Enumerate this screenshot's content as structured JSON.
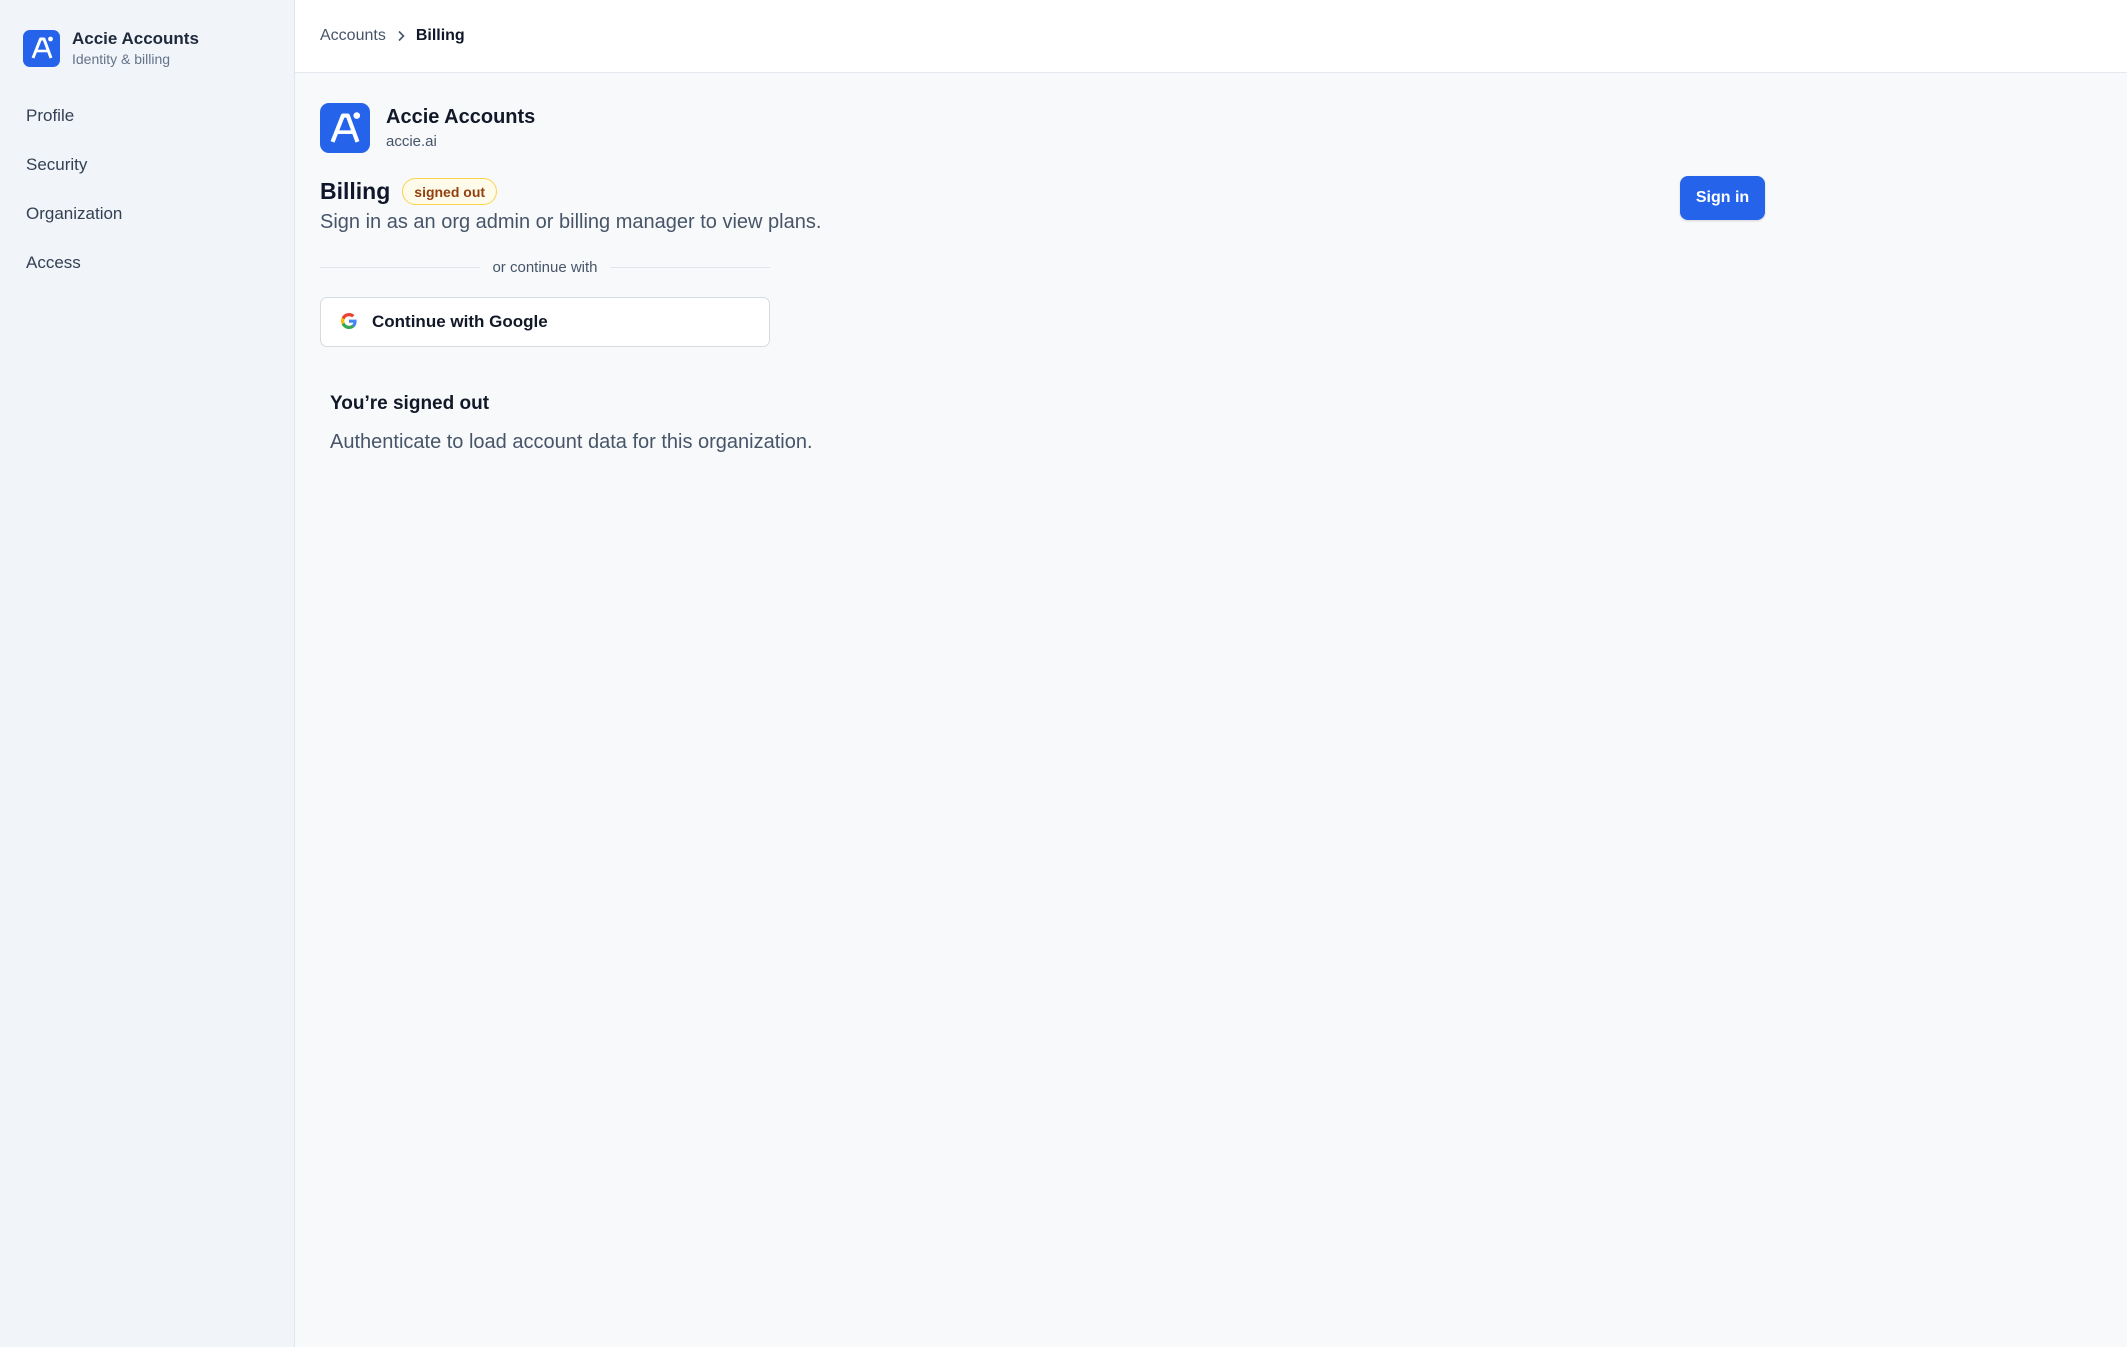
{
  "sidebar": {
    "brand": {
      "title": "Accie Accounts",
      "subtitle": "Identity & billing",
      "logo_icon": "accie-logo-icon"
    },
    "items": [
      {
        "label": "Profile"
      },
      {
        "label": "Security"
      },
      {
        "label": "Organization"
      },
      {
        "label": "Access"
      }
    ]
  },
  "breadcrumb": {
    "parent": "Accounts",
    "separator_icon": "chevron-right-icon",
    "current": "Billing"
  },
  "app": {
    "name": "Accie Accounts",
    "domain": "accie.ai"
  },
  "page": {
    "title": "Billing",
    "status_badge": "signed out",
    "subtitle": "Sign in as an org admin or billing manager to view plans.",
    "sign_in_label": "Sign in",
    "divider_label": "or continue with",
    "google_label": "Continue with Google",
    "notice_title": "You’re signed out",
    "notice_body": "Authenticate to load account data for this organization."
  },
  "colors": {
    "accent": "#2563eb",
    "badge_bg": "#fffbeb",
    "badge_border": "#fcd34d",
    "badge_text": "#92400e"
  }
}
